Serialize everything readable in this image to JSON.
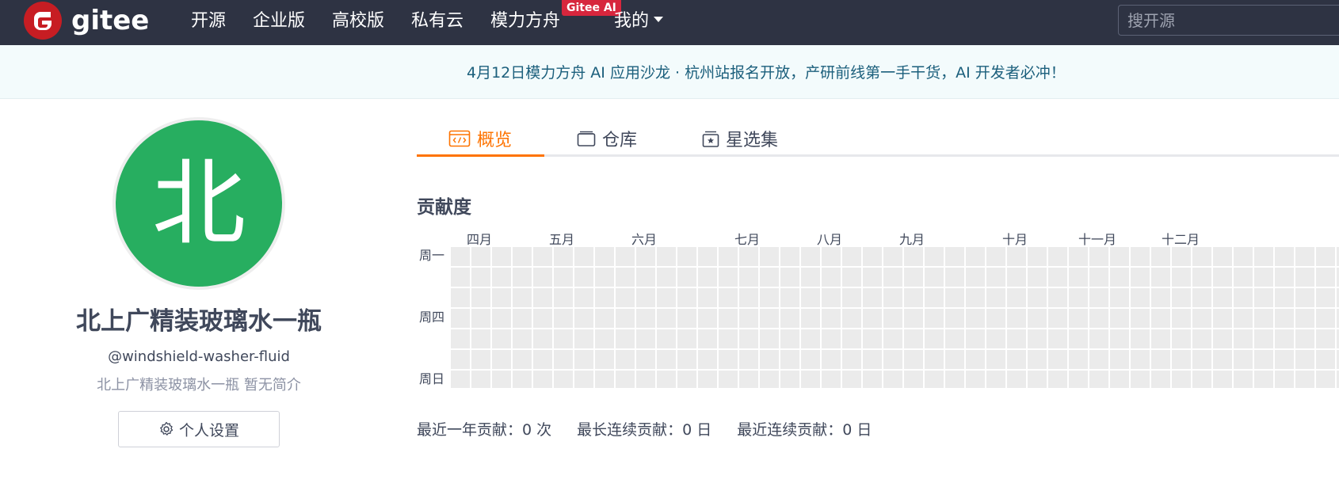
{
  "nav": {
    "logo_text": "gitee",
    "items": [
      "开源",
      "企业版",
      "高校版",
      "私有云",
      "模力方舟"
    ],
    "ai_badge": "Gitee AI",
    "mine_label": "我的",
    "search_placeholder": "搜开源"
  },
  "announcement": "4月12日模力方舟 AI 应用沙龙 · 杭州站报名开放，产研前线第一手干货，AI 开发者必冲！",
  "profile": {
    "avatar_char": "北",
    "avatar_color": "#27ae60",
    "name": "北上广精装玻璃水一瓶",
    "handle": "@windshield-washer-fluid",
    "bio": "北上广精装玻璃水一瓶 暂无简介",
    "settings_label": "个人设置"
  },
  "tabs": [
    "概览",
    "仓库",
    "星选集"
  ],
  "contributions": {
    "title": "贡献度",
    "months": [
      "四月",
      "五月",
      "六月",
      "七月",
      "八月",
      "九月",
      "十月",
      "十一月",
      "十二月"
    ],
    "weekdays": [
      "周一",
      "周四",
      "周日"
    ],
    "summary": {
      "year": "最近一年贡献：0 次",
      "longest": "最长连续贡献：0 日",
      "recent": "最近连续贡献：0 日"
    }
  },
  "colors": {
    "nav_bg": "#2e3343",
    "accent": "#fe7300",
    "brand_red": "#c71d23",
    "empty_cell": "#ebebeb"
  }
}
